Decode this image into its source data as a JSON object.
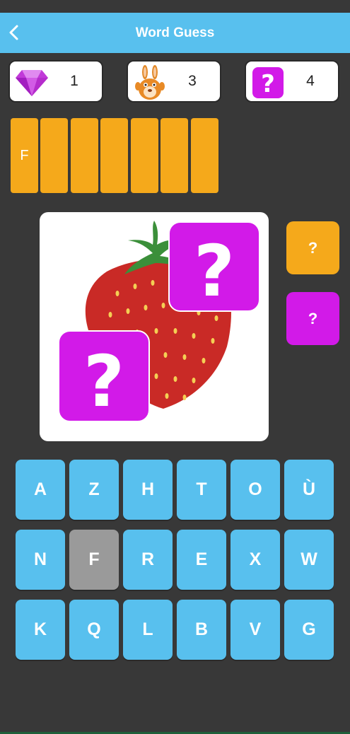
{
  "header": {
    "title": "Word Guess",
    "back_icon": "chevron-left-icon"
  },
  "stats": {
    "gems": {
      "icon": "gem-icon",
      "value": "1"
    },
    "bunny": {
      "icon": "bunny-icon",
      "value": "3"
    },
    "hints": {
      "icon": "question-icon",
      "value": "4"
    }
  },
  "answer_slots": [
    "F",
    "",
    "",
    "",
    "",
    "",
    ""
  ],
  "picture": {
    "subject_icon": "strawberry-icon",
    "hidden_tiles": [
      "?",
      "?"
    ]
  },
  "hint_buttons": [
    {
      "label": "?",
      "color": "#f5a91b"
    },
    {
      "label": "?",
      "color": "#d21ae8"
    }
  ],
  "keyboard": {
    "rows": [
      [
        "A",
        "Z",
        "H",
        "T",
        "O",
        "Ù"
      ],
      [
        "N",
        "F",
        "R",
        "E",
        "X",
        "W"
      ],
      [
        "K",
        "Q",
        "L",
        "B",
        "V",
        "G"
      ]
    ],
    "used": [
      "F"
    ]
  },
  "colors": {
    "accent": "#58c0ee",
    "slot": "#f5a91b",
    "hint_purple": "#d21ae8",
    "key_used": "#9a9a9a",
    "background": "#383838"
  }
}
